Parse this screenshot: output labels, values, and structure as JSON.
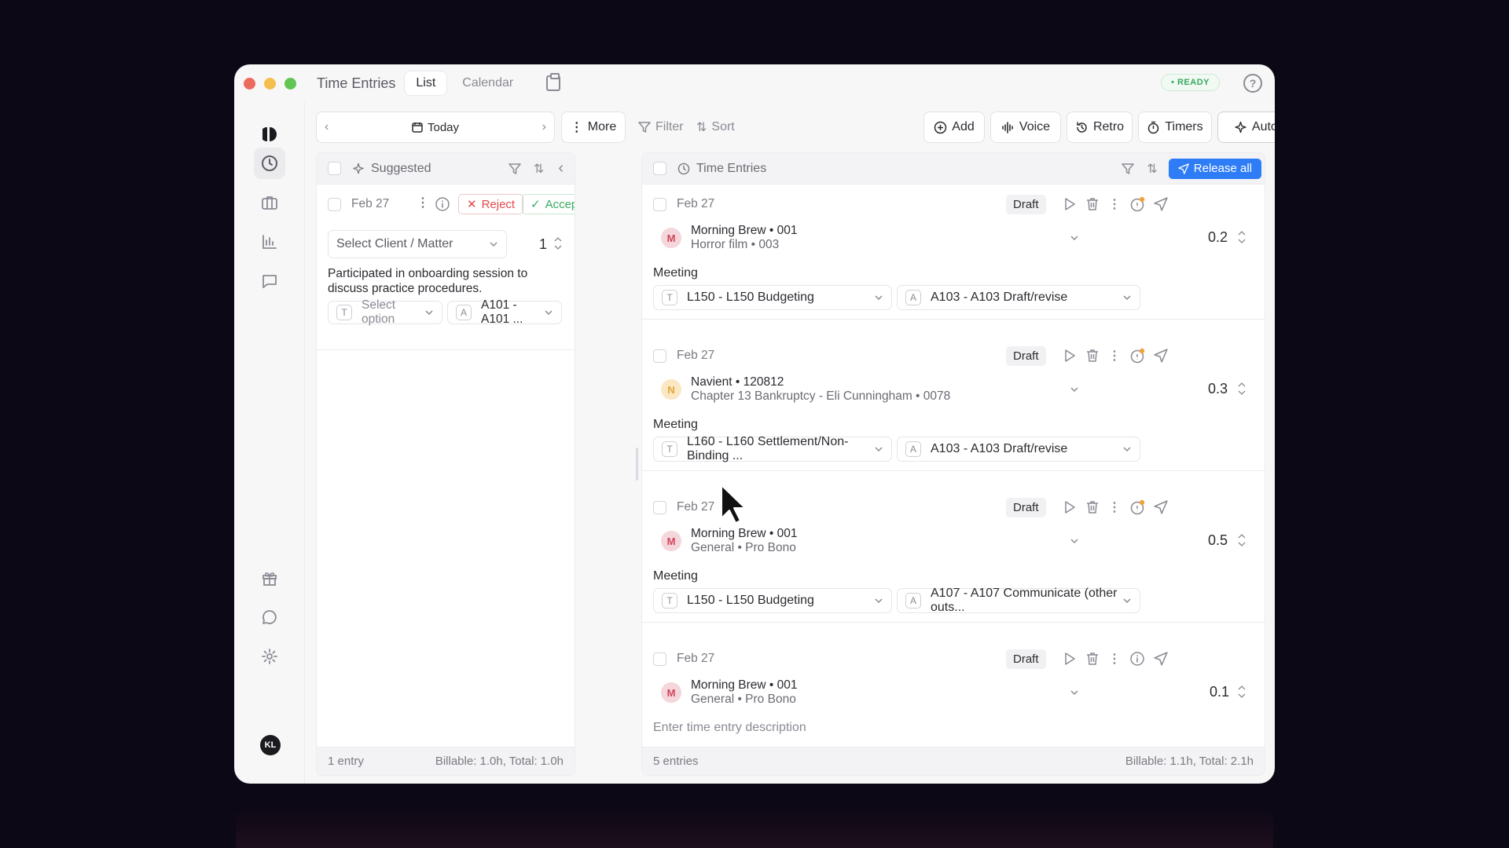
{
  "window": {
    "title": "Time Entries",
    "tabs": [
      "List",
      "Calendar"
    ],
    "status_badge": "• READY"
  },
  "sidebar": {
    "user_initials": "KL"
  },
  "toolbar": {
    "today": "Today",
    "more": "More",
    "filter": "Filter",
    "sort": "Sort",
    "add": "Add",
    "voice": "Voice",
    "retro": "Retro",
    "timers": "Timers",
    "auto_capture": "Auto-Capture"
  },
  "suggested": {
    "header": "Suggested",
    "entry": {
      "date": "Feb 27",
      "reject": "Reject",
      "accept": "Accept",
      "client_placeholder": "Select Client / Matter",
      "hours": "1",
      "description": "Participated in onboarding session to discuss practice procedures.",
      "task_placeholder": "Select option",
      "activity": "A101 - A101 ..."
    },
    "footer_count": "1 entry",
    "footer_totals": "Billable: 1.0h, Total: 1.0h"
  },
  "entries": {
    "header": "Time Entries",
    "release_all": "Release all",
    "items": [
      {
        "date": "Feb 27",
        "status": "Draft",
        "avatar": "M",
        "client": "Morning Brew • 001",
        "matter": "Horror film • 003",
        "hours": "0.2",
        "description": "Meeting",
        "task": "L150 - L150 Budgeting",
        "activity": "A103 - A103 Draft/revise"
      },
      {
        "date": "Feb 27",
        "status": "Draft",
        "avatar": "N",
        "client": "Navient • 120812",
        "matter": "Chapter 13 Bankruptcy - Eli Cunningham • 0078",
        "hours": "0.3",
        "description": "Meeting",
        "task": "L160 - L160 Settlement/Non-Binding ...",
        "activity": "A103 - A103 Draft/revise"
      },
      {
        "date": "Feb 27",
        "status": "Draft",
        "avatar": "M",
        "client": "Morning Brew • 001",
        "matter": "General • Pro Bono",
        "hours": "0.5",
        "description": "Meeting",
        "task": "L150 - L150 Budgeting",
        "activity": "A107 - A107 Communicate (other outs..."
      },
      {
        "date": "Feb 27",
        "status": "Draft",
        "avatar": "M",
        "client": "Morning Brew • 001",
        "matter": "General • Pro Bono",
        "hours": "0.1",
        "description_placeholder": "Enter time entry description"
      }
    ],
    "footer_count": "5 entries",
    "footer_totals": "Billable: 1.1h, Total: 2.1h"
  },
  "colors": {
    "accent": "#2f7df6",
    "reject": "#e5484d",
    "accept": "#3aa860",
    "ready": "#3aa860",
    "warning_dot": "#f0a33a"
  },
  "icons": [
    "clock-icon",
    "briefcase-icon",
    "chart-icon",
    "message-icon",
    "gift-icon",
    "chat-icon",
    "gear-icon",
    "play-icon",
    "trash-icon",
    "send-icon"
  ]
}
